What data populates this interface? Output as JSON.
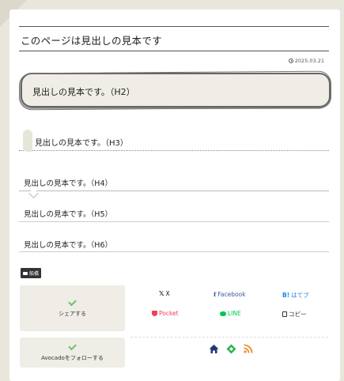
{
  "page_title": "このページは見出しの見本です",
  "date": "2025.03.21",
  "headings": {
    "h2": "見出しの見本です。（H2）",
    "h3": "見出しの見本です。（H3）",
    "h4": "見出しの見本です。（H4）",
    "h5": "見出しの見本です。（H5）",
    "h6": "見出しの見本です。（H6）"
  },
  "category": "船橋",
  "share": {
    "label": "シェアする",
    "buttons": [
      {
        "icon": "x-icon",
        "label": "X",
        "color": "#111111"
      },
      {
        "icon": "facebook-icon",
        "label": "Facebook",
        "color": "#3b5998"
      },
      {
        "icon": "hatena-icon",
        "label": "はてブ",
        "color": "#1e88e5"
      },
      {
        "icon": "pocket-icon",
        "label": "Pocket",
        "color": "#ef4056"
      },
      {
        "icon": "line-icon",
        "label": "LINE",
        "color": "#06c755"
      },
      {
        "icon": "copy-icon",
        "label": "コピー",
        "color": "#333333"
      }
    ]
  },
  "follow": {
    "label": "Avocadoをフォローする",
    "icons": [
      "home-icon",
      "feedly-icon",
      "rss-icon"
    ]
  },
  "colors": {
    "accent_check": "#6bc06b",
    "box_bg": "#efede6",
    "page_bg": "#e9e7dc"
  }
}
